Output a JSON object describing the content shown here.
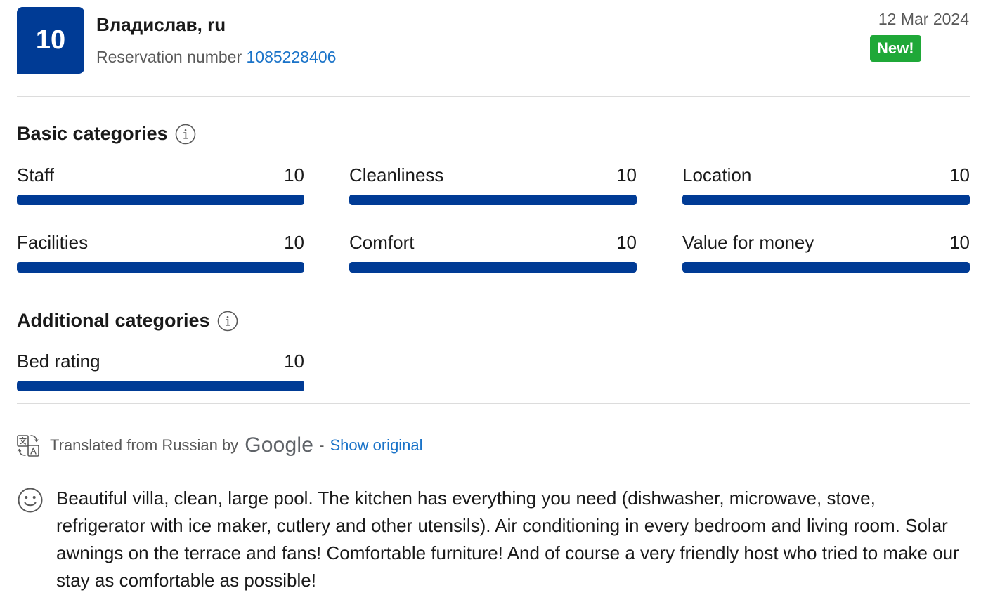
{
  "review": {
    "score": "10",
    "guest": "Владислав, ru",
    "reservation_label": "Reservation number",
    "reservation_number": "1085228406",
    "date": "12 Mar 2024",
    "badge": "New!"
  },
  "basic": {
    "title": "Basic categories",
    "items": [
      {
        "label": "Staff",
        "value": "10",
        "fraction": 1.0
      },
      {
        "label": "Cleanliness",
        "value": "10",
        "fraction": 1.0
      },
      {
        "label": "Location",
        "value": "10",
        "fraction": 1.0
      },
      {
        "label": "Facilities",
        "value": "10",
        "fraction": 1.0
      },
      {
        "label": "Comfort",
        "value": "10",
        "fraction": 1.0
      },
      {
        "label": "Value for money",
        "value": "10",
        "fraction": 1.0
      }
    ]
  },
  "additional": {
    "title": "Additional categories",
    "items": [
      {
        "label": "Bed rating",
        "value": "10",
        "fraction": 1.0
      }
    ]
  },
  "translation": {
    "prefix": "Translated from Russian by",
    "provider": "Google",
    "separator": "-",
    "link": "Show original"
  },
  "comment": {
    "icon": "smile-icon",
    "text": "Beautiful villa, clean, large pool. The kitchen has everything you need (dishwasher, microwave, stove, refrigerator with ice maker, cutlery and other utensils). Air conditioning in every bedroom and living room. Solar awnings on the terrace and fans! Comfortable furniture! And of course a very friendly host who tried to make our stay as comfortable as possible!"
  },
  "colors": {
    "brand": "#003b95",
    "link": "#1a73c8",
    "badge": "#1fa838"
  }
}
